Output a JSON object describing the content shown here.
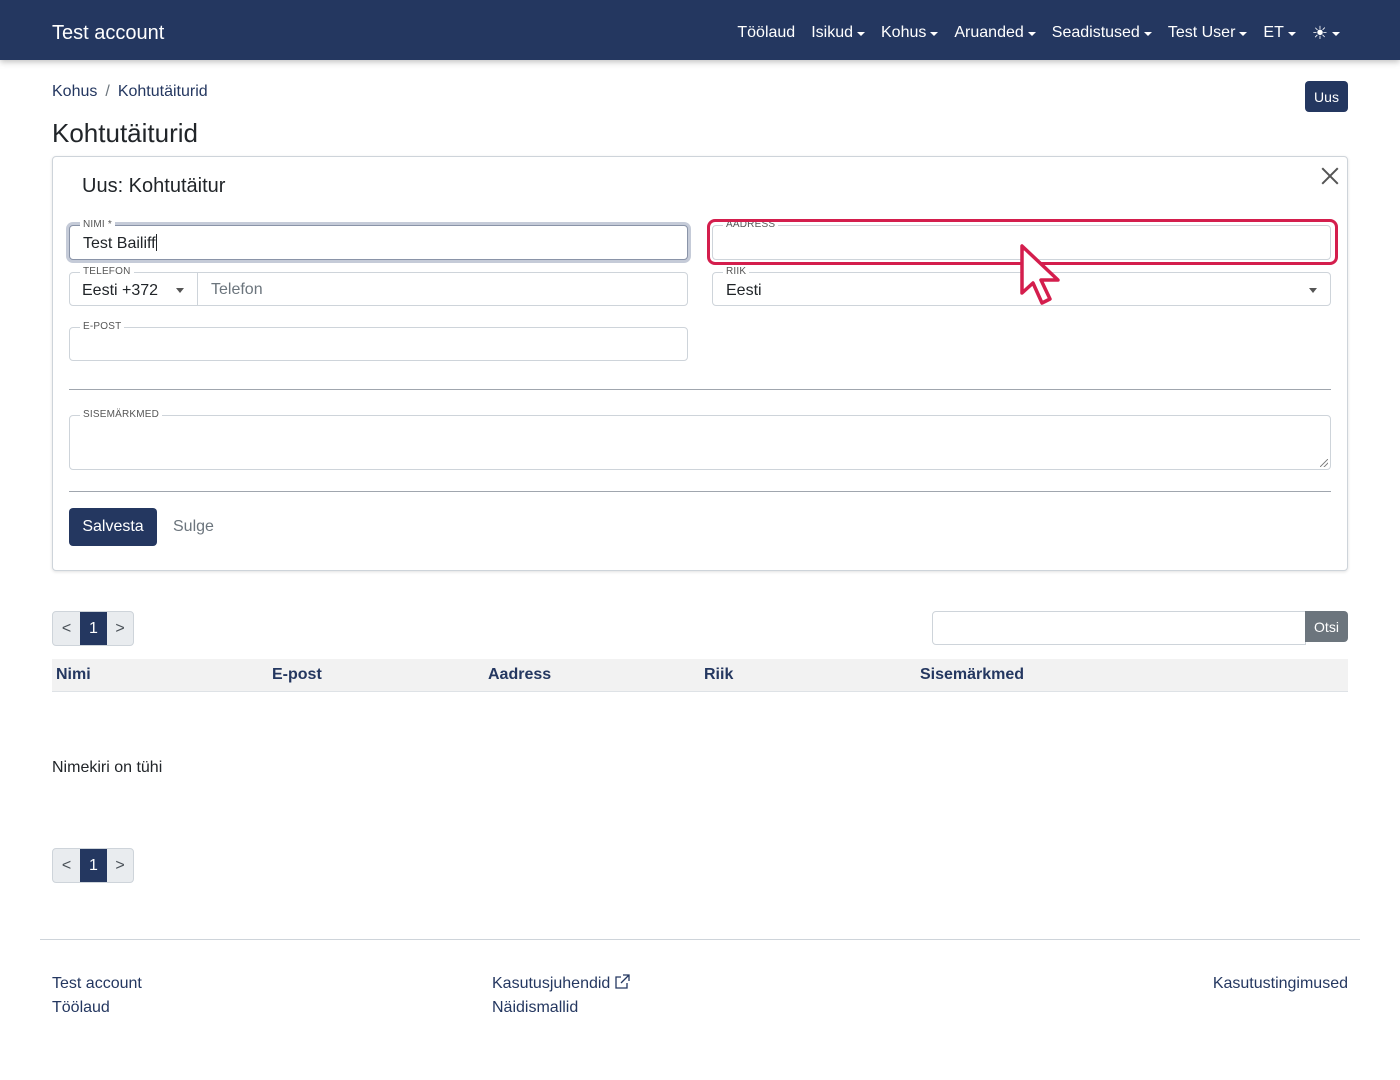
{
  "navbar": {
    "brand": "Test account",
    "items": [
      {
        "label": "Töölaud",
        "dropdown": false
      },
      {
        "label": "Isikud",
        "dropdown": true
      },
      {
        "label": "Kohus",
        "dropdown": true
      },
      {
        "label": "Aruanded",
        "dropdown": true
      },
      {
        "label": "Seadistused",
        "dropdown": true
      },
      {
        "label": "Test User",
        "dropdown": true
      },
      {
        "label": "ET",
        "dropdown": true
      }
    ],
    "theme_icon": "☀"
  },
  "breadcrumb": [
    "Kohus",
    "Kohtutäiturid"
  ],
  "new_button": "Uus",
  "page_title": "Kohtutäiturid",
  "form": {
    "title": "Uus: Kohtutäitur",
    "name": {
      "label": "Nimi *",
      "value": "Test Bailiff"
    },
    "address": {
      "label": "Aadress",
      "value": ""
    },
    "phone": {
      "label": "Telefon",
      "country_code": "Eesti +372",
      "placeholder": "Telefon"
    },
    "country": {
      "label": "Riik",
      "value": "Eesti"
    },
    "email": {
      "label": "E-post",
      "value": ""
    },
    "notes": {
      "label": "Sisemärkmed",
      "value": ""
    },
    "save_label": "Salvesta",
    "close_label": "Sulge"
  },
  "pagination": {
    "prev": "<",
    "current": "1",
    "next": ">"
  },
  "search": {
    "button": "Otsi",
    "value": ""
  },
  "table": {
    "columns": [
      "Nimi",
      "E-post",
      "Aadress",
      "Riik",
      "Sisemärkmed"
    ],
    "empty_text": "Nimekiri on tühi"
  },
  "footer": {
    "col1": [
      "Test account",
      "Töölaud"
    ],
    "col2": [
      "Kasutusjuhendid",
      "Näidismallid"
    ],
    "col3": [
      "Kasutustingimused"
    ]
  },
  "colors": {
    "primary": "#243760",
    "highlight": "#d41e4d",
    "secondary": "#6c757d"
  }
}
